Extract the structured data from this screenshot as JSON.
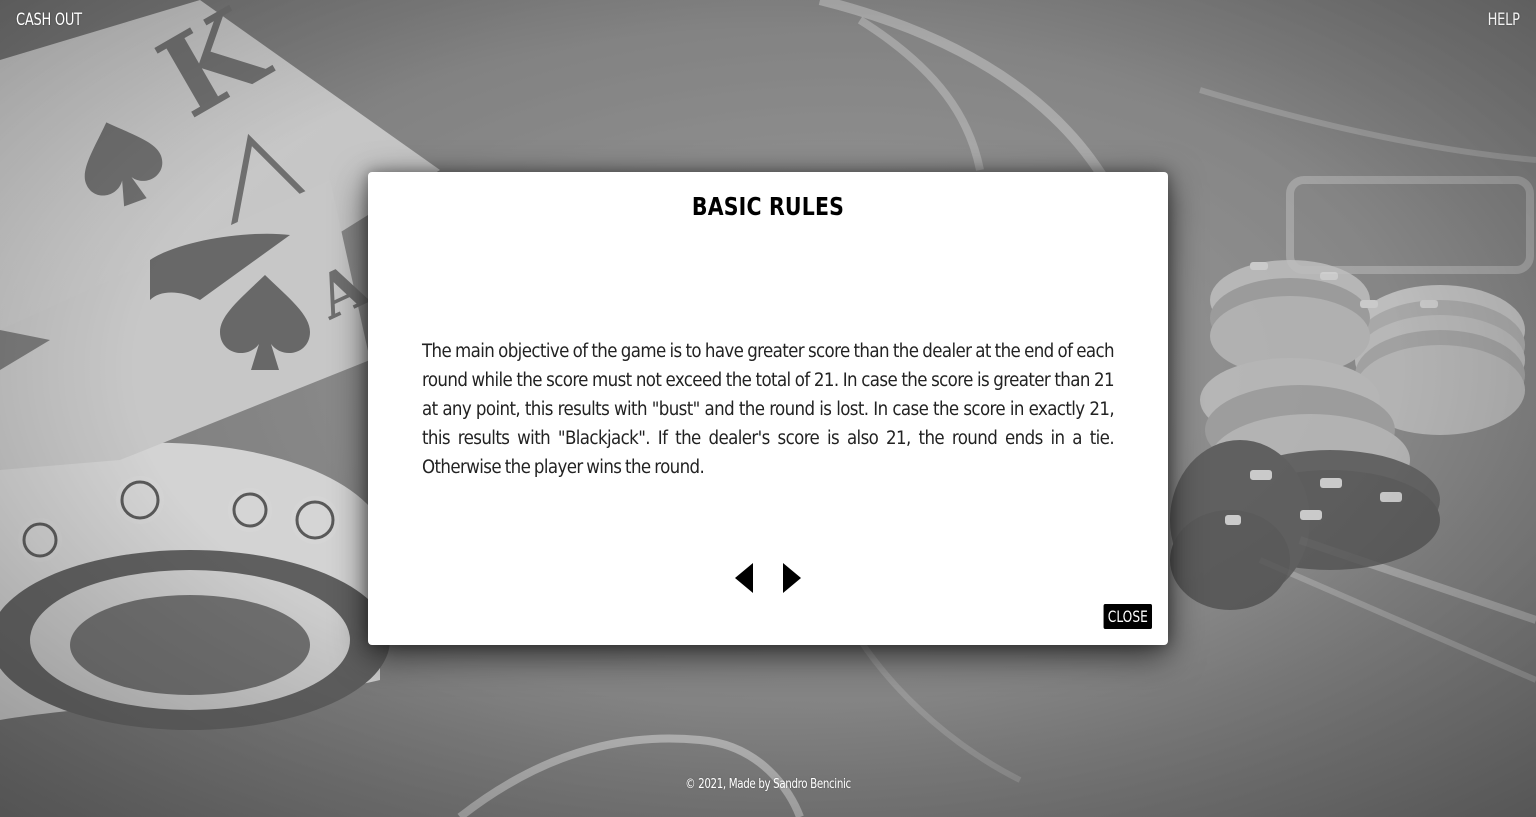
{
  "header": {
    "cash_out_label": "CASH OUT",
    "help_label": "HELP"
  },
  "modal": {
    "title": "BASIC RULES",
    "body": "The main objective of the game is to have greater score than the dealer at the end of each round while the score must not exceed the total of 21. In case the score is greater than 21 at any point, this results with \"bust\" and the round is lost. In case the score in exactly 21, this results with \"Blackjack\". If the dealer's score is also 21, the round ends in a tie. Otherwise the player wins the round.",
    "prev_icon": "triangle-left-icon",
    "next_icon": "triangle-right-icon",
    "close_label": "CLOSE"
  },
  "footer": {
    "text": "© 2021, Made by Sandro Bencinic"
  },
  "colors": {
    "modal_bg": "#ffffff",
    "button_bg": "#000000",
    "text": "#222222"
  }
}
